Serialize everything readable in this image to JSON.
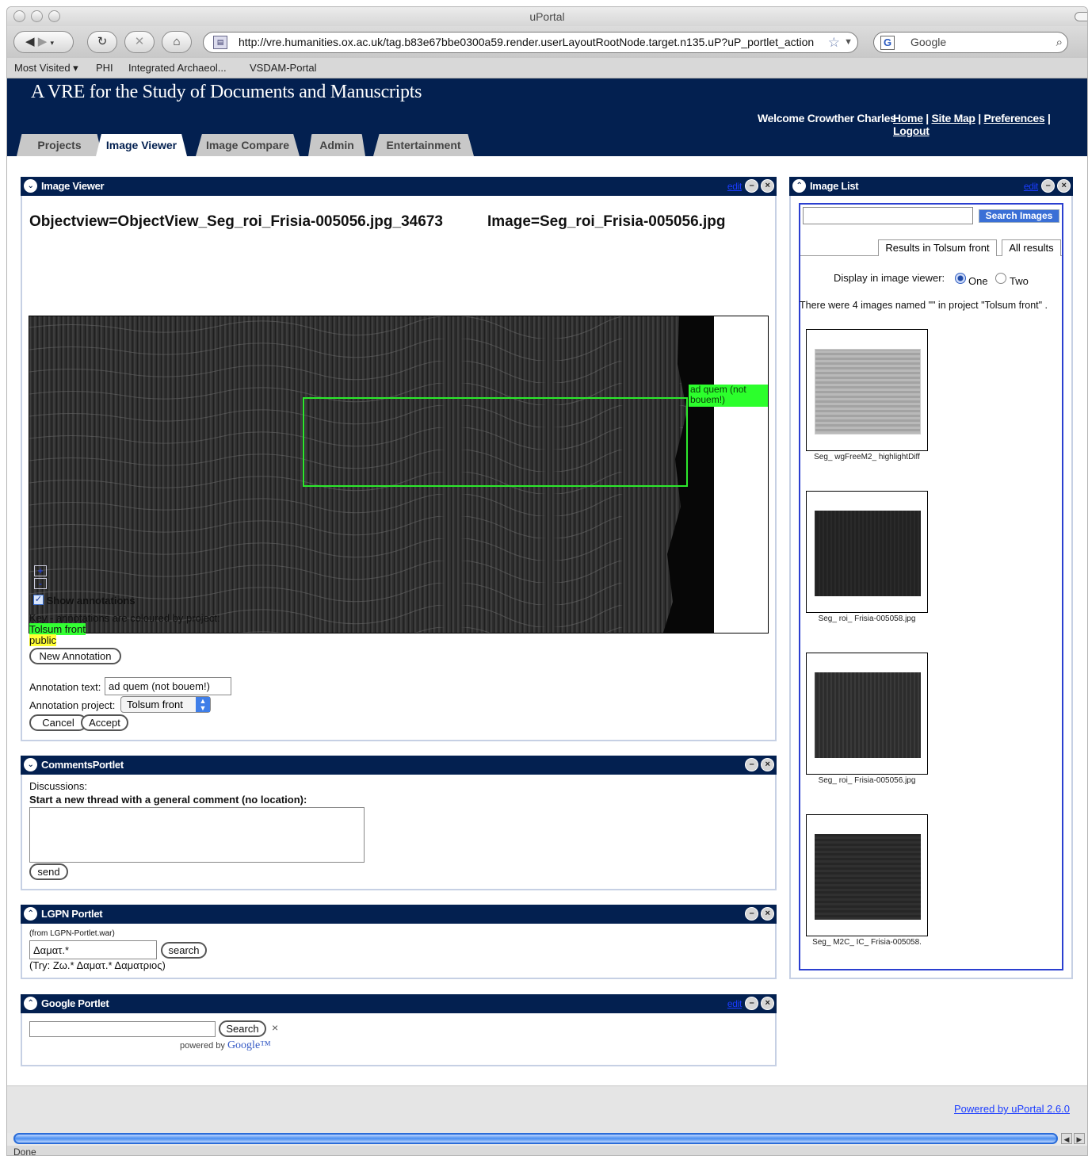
{
  "window": {
    "title": "uPortal"
  },
  "browser": {
    "url": "http://vre.humanities.ox.ac.uk/tag.b83e67bbe0300a59.render.userLayoutRootNode.target.n135.uP?uP_portlet_action",
    "search_placeholder": "Google",
    "bookmarks": [
      "Most Visited ▾",
      "PHI",
      "Integrated Archaeol...",
      "VSDAM-Portal"
    ],
    "status": "Done"
  },
  "site": {
    "title": "A VRE for the Study of Documents and Manuscripts",
    "welcome": "Welcome Crowther Charles",
    "links": [
      "Home",
      "Site Map",
      "Preferences",
      "Logout"
    ],
    "link_sep": "|"
  },
  "tabs": [
    "Projects",
    "Image Viewer",
    "Image Compare",
    "Admin",
    "Entertainment"
  ],
  "image_viewer": {
    "title": "Image Viewer",
    "edit_label": "edit",
    "objectview": "Objectview=ObjectView_Seg_roi_Frisia-005056.jpg_34673",
    "image_name": "Image=Seg_roi_Frisia-005056.jpg",
    "annotation_label": "ad quem (not bouem!)",
    "zoom_in": "+",
    "zoom_out": "-",
    "show_annotations": "Show annotations",
    "key_text": "Key - annotations are coloured by project:",
    "key_projects": [
      {
        "name": "Tolsum front",
        "color": "#33ff33"
      },
      {
        "name": "public",
        "color": "#ffff33"
      }
    ],
    "new_annotation": "New Annotation",
    "annotation_text_label": "Annotation text:",
    "annotation_text_value": "ad quem (not bouem!)",
    "annotation_project_label": "Annotation project:",
    "annotation_project_value": "Tolsum front",
    "cancel": "Cancel",
    "accept": "Accept"
  },
  "comments": {
    "title": "CommentsPortlet",
    "discussions": "Discussions:",
    "start_thread": "Start a new thread with a general comment (no location):",
    "send": "send"
  },
  "lgpn": {
    "title": "LGPN Portlet",
    "from": "(from LGPN-Portlet.war)",
    "query": "Δαματ.*",
    "search": "search",
    "try_text": "(Try: Ζω.* Δαματ.* Δαματριος)"
  },
  "google": {
    "title": "Google Portlet",
    "edit_label": "edit",
    "search": "Search",
    "clear": "×",
    "powered_by": "powered by",
    "brand": "Google™"
  },
  "image_list": {
    "title": "Image List",
    "edit_label": "edit",
    "search_button": "Search Images",
    "tab_results": "Results in Tolsum front",
    "tab_all": "All results",
    "display_label": "Display in image viewer:",
    "option_one": "One",
    "option_two": "Two",
    "summary": "There were 4 images named \"\" in project \"Tolsum front\" .",
    "thumbnails": [
      {
        "caption": "Seg_ wgFreeM2_ highlightDiff"
      },
      {
        "caption": "Seg_ roi_ Frisia-005058.jpg"
      },
      {
        "caption": "Seg_ roi_ Frisia-005056.jpg"
      },
      {
        "caption": "Seg_ M2C_ IC_ Frisia-005058."
      }
    ]
  },
  "footer": {
    "powered_by": "Powered by uPortal 2.6.0"
  }
}
